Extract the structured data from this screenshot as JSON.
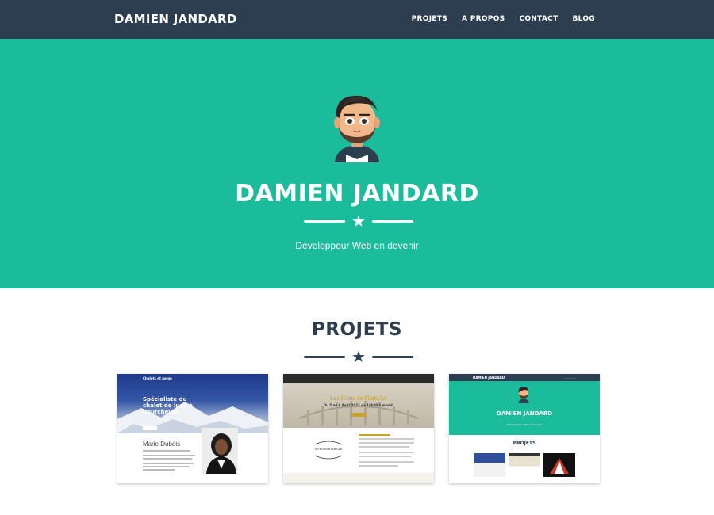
{
  "navbar": {
    "brand": "DAMIEN JANDARD",
    "links": [
      "PROJETS",
      "A PROPOS",
      "CONTACT",
      "BLOG"
    ]
  },
  "hero": {
    "title": "DAMIEN JANDARD",
    "subtitle": "Développeur Web en devenir"
  },
  "projects": {
    "title": "PROJETS",
    "cards": [
      {
        "logo": "Chalets et neige",
        "heading": "Spécialiste du chalet de luxe à Courchevel.",
        "name": "Marie Dubois"
      },
      {
        "title": "Les Films de Plein Air",
        "subtitle": "Du 5 au 8 Août 2023 de 18h00 à minuit",
        "logo_text": "LES FILMS DE PLEIN AIR"
      },
      {
        "brand": "DAMIEN JANDARD",
        "title": "DAMIEN JANDARD",
        "subtitle": "Développeur Web en devenir",
        "section": "PROJETS"
      }
    ]
  },
  "colors": {
    "navbar": "#2c3e50",
    "hero": "#1abc9c",
    "heading": "#2c3e50"
  },
  "icons": [
    "star-icon",
    "avatar-illustration"
  ]
}
